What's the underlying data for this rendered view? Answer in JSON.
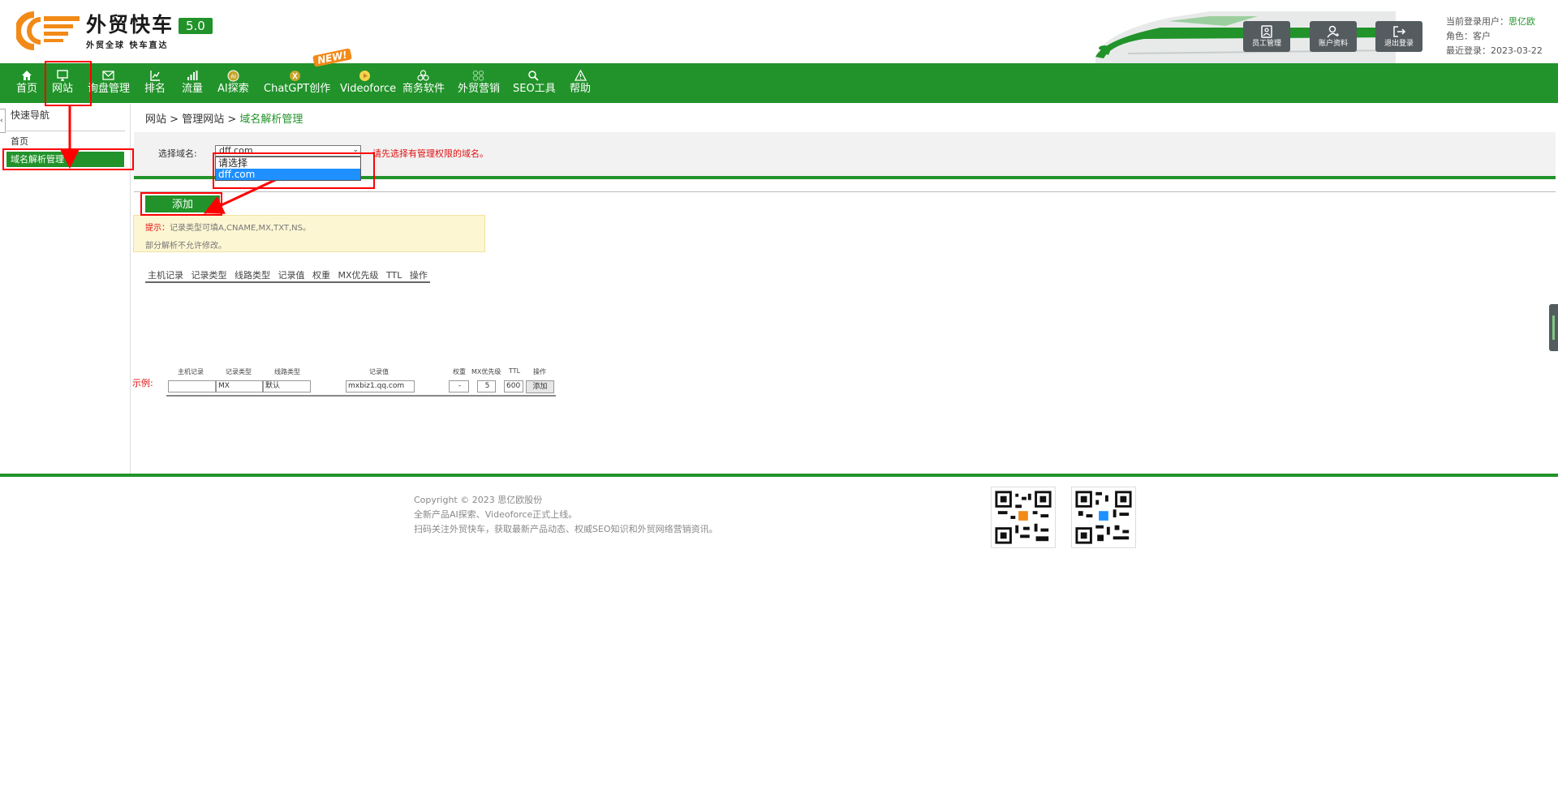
{
  "brand": {
    "name": "外贸快车",
    "version": "5.0",
    "slogan": "外贸全球 快车直达"
  },
  "header_buttons": [
    {
      "label": "员工管理",
      "icon": "staff-icon"
    },
    {
      "label": "账户资料",
      "icon": "account-icon"
    },
    {
      "label": "退出登录",
      "icon": "logout-icon"
    }
  ],
  "user": {
    "current_label": "当前登录用户：",
    "current_value": "思亿欧",
    "role_label": "角色：",
    "role_value": "客户",
    "last_login_label": "最近登录：",
    "last_login_value": "2023-03-22"
  },
  "nav": [
    {
      "label": "首页",
      "icon": "home-icon"
    },
    {
      "label": "网站",
      "icon": "monitor-icon"
    },
    {
      "label": "询盘管理",
      "icon": "mail-icon"
    },
    {
      "label": "排名",
      "icon": "ranking-icon"
    },
    {
      "label": "流量",
      "icon": "traffic-icon"
    },
    {
      "label": "AI探索",
      "icon": "ai-icon"
    },
    {
      "label": "ChatGPT创作",
      "icon": "chatgpt-icon"
    },
    {
      "label": "Videoforce",
      "icon": "video-icon"
    },
    {
      "label": "商务软件",
      "icon": "software-icon"
    },
    {
      "label": "外贸营销",
      "icon": "marketing-icon"
    },
    {
      "label": "SEO工具",
      "icon": "search-icon"
    },
    {
      "label": "帮助",
      "icon": "help-icon"
    }
  ],
  "new_badge": "NEW!",
  "sidebar": {
    "title": "快速导航",
    "home": "首页",
    "active": "域名解析管理"
  },
  "breadcrumb": {
    "part1": "网站",
    "sep": " > ",
    "part2": "管理网站",
    "current": "域名解析管理"
  },
  "domain_select": {
    "label": "选择域名:",
    "value": "dff.com",
    "options": [
      "请选择",
      "dff.com"
    ],
    "hint": "请先选择有管理权限的域名。"
  },
  "add_button": "添加",
  "tips": {
    "prefix": "提示：",
    "line1": "记录类型可填A,CNAME,MX,TXT,NS。",
    "line2": "部分解析不允许修改。"
  },
  "columns": [
    "主机记录",
    "记录类型",
    "线路类型",
    "记录值",
    "权重",
    "MX优先级",
    "TTL",
    "操作"
  ],
  "example": {
    "label": "示例:",
    "headers": [
      "主机记录",
      "记录类型",
      "线路类型",
      "记录值",
      "权重",
      "MX优先级",
      "TTL",
      "操作"
    ],
    "host": "",
    "type": "MX",
    "line": "默认",
    "value": "mxbiz1.qq.com",
    "weight": "-",
    "mx": "5",
    "ttl": "600",
    "button": "添加"
  },
  "footer": {
    "line1": "Copyright © 2023 思亿欧股份",
    "line2": "全新产品AI探索、Videoforce正式上线。",
    "line3": "扫码关注外贸快车，获取最新产品动态、权威SEO知识和外贸网络营销资讯。"
  },
  "colors": {
    "primary_green": "#21932a",
    "accent_orange": "#f28a18",
    "alert_red": "#e01010",
    "highlight_blue": "#1e90ff"
  }
}
